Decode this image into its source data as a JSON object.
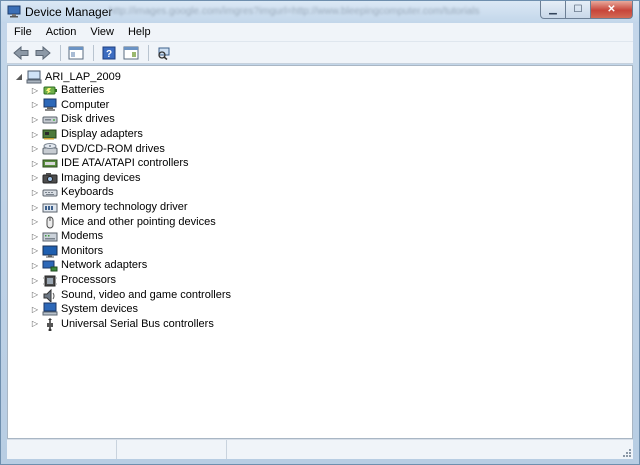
{
  "window": {
    "title": "Device Manager",
    "blurred_url": "http://images.google.com/imgres?imgurl=http://www.bleepingcomputer.com/tutorials"
  },
  "menu": [
    "File",
    "Action",
    "View",
    "Help"
  ],
  "toolbar": {
    "buttons": [
      "back-icon",
      "forward-icon",
      "show-hide-console-tree-icon",
      "properties-icon",
      "help-icon",
      "scan-hardware-icon"
    ]
  },
  "tree": {
    "root_label": "ARI_LAP_2009",
    "items": [
      {
        "label": "Batteries",
        "icon": "battery-icon"
      },
      {
        "label": "Computer",
        "icon": "computer-icon"
      },
      {
        "label": "Disk drives",
        "icon": "disk-drive-icon"
      },
      {
        "label": "Display adapters",
        "icon": "display-adapter-icon"
      },
      {
        "label": "DVD/CD-ROM drives",
        "icon": "dvd-drive-icon"
      },
      {
        "label": "IDE ATA/ATAPI controllers",
        "icon": "ide-controller-icon"
      },
      {
        "label": "Imaging devices",
        "icon": "camera-icon"
      },
      {
        "label": "Keyboards",
        "icon": "keyboard-icon"
      },
      {
        "label": "Memory technology driver",
        "icon": "memory-icon"
      },
      {
        "label": "Mice and other pointing devices",
        "icon": "mouse-icon"
      },
      {
        "label": "Modems",
        "icon": "modem-icon"
      },
      {
        "label": "Monitors",
        "icon": "monitor-icon"
      },
      {
        "label": "Network adapters",
        "icon": "network-icon"
      },
      {
        "label": "Processors",
        "icon": "processor-icon"
      },
      {
        "label": "Sound, video and game controllers",
        "icon": "speaker-icon"
      },
      {
        "label": "System devices",
        "icon": "system-device-icon"
      },
      {
        "label": "Universal Serial Bus controllers",
        "icon": "usb-icon"
      }
    ]
  }
}
